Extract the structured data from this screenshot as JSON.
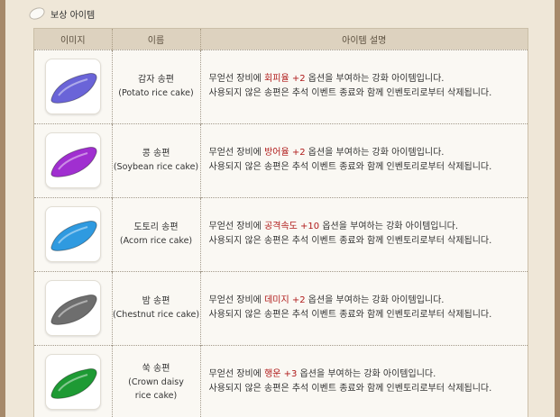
{
  "section": {
    "title": "보상 아이템",
    "icon": "rice-cake-icon"
  },
  "table": {
    "headers": {
      "image": "이미지",
      "name": "이름",
      "desc": "아이템 설명"
    },
    "rows": [
      {
        "name_ko": "감자 송편",
        "name_en": "(Potato rice cake)",
        "color": "#6a64d8",
        "desc_pre": "무얻선 장비에 ",
        "desc_hl": "회피율 +2",
        "desc_post": " 옵션을 부여하는 강화 아이템입니다.",
        "desc_line2": "사용되지 않은 송편은 추석 이벤트 종료와 함께 인벤토리로부터 삭제됩니다."
      },
      {
        "name_ko": "콩 송편",
        "name_en": "(Soybean rice cake)",
        "color": "#a02fd0",
        "desc_pre": "무얻선 장비에 ",
        "desc_hl": "방어율 +2",
        "desc_post": " 옵션을 부여하는 강화 아이템입니다.",
        "desc_line2": "사용되지 않은 송편은 추석 이벤트 종료와 함께 인벤토리로부터 삭제됩니다."
      },
      {
        "name_ko": "도토리 송편",
        "name_en": "(Acorn rice cake)",
        "color": "#2f9ae0",
        "desc_pre": "무얻선 장비에 ",
        "desc_hl": "공격속도 +10",
        "desc_post": " 옵션을 부여하는 강화 아이템입니다.",
        "desc_line2": "사용되지 않은 송편은 추석 이벤트 종료와 함께 인벤토리로부터 삭제됩니다."
      },
      {
        "name_ko": "밤 송편",
        "name_en": "(Chestnut rice cake)",
        "color": "#6e6e6e",
        "desc_pre": "무얻선 장비에 ",
        "desc_hl": "데미지 +2",
        "desc_post": " 옵션을 부여하는 강화 아이템입니다.",
        "desc_line2": "사용되지 않은 송편은 추석 이벤트 종료와 함께 인벤토리로부터 삭제됩니다."
      },
      {
        "name_ko": "쑥 송편",
        "name_en": "(Crown daisy",
        "name_en2": "rice cake)",
        "color": "#1e9a34",
        "desc_pre": "무얻선 장비에 ",
        "desc_hl": "행운 +3",
        "desc_post": " 옵션을 부여하는 강화 아이템입니다.",
        "desc_line2": "사용되지 않은 송편은 추석 이벤트 종료와 함께 인벤토리로부터 삭제됩니다."
      }
    ]
  }
}
